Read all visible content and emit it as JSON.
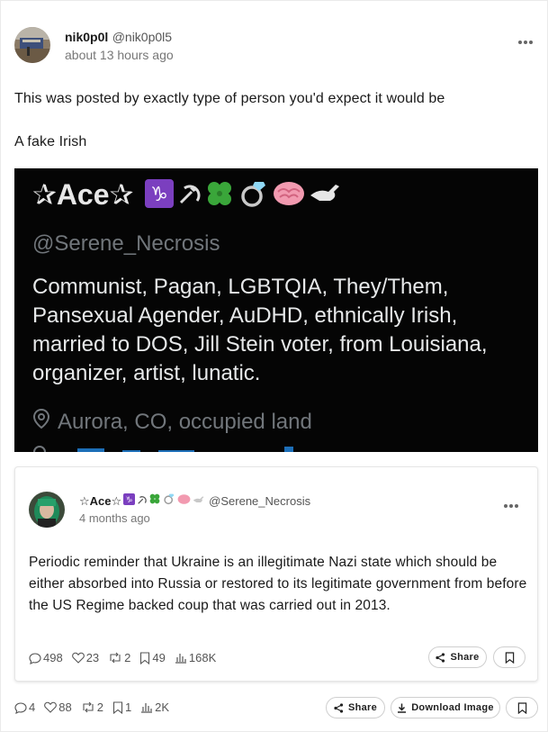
{
  "post": {
    "author_name": "nik0p0l",
    "author_handle": "@nik0p0l5",
    "timestamp": "about 13 hours ago",
    "text_line1": "This was posted by exactly type of person you'd expect it would be",
    "text_line2": "A fake Irish",
    "stats": {
      "replies": "4",
      "likes": "88",
      "reposts": "2",
      "bookmarks": "1",
      "views": "2K"
    },
    "share_label": "Share",
    "download_label": "Download Image"
  },
  "image": {
    "display_name": "✰Ace✰",
    "handle": "@Serene_Necrosis",
    "bio": "Communist, Pagan, LGBTQIA, They/Them, Pansexual Agender, AuDHD, ethnically Irish, married to DOS, Jill Stein voter, from Louisiana, organizer, artist, lunatic.",
    "location": "Aurora, CO, occupied land"
  },
  "quote": {
    "author_name": "☆Ace☆",
    "author_handle": "@Serene_Necrosis",
    "timestamp": "4 months ago",
    "text": "Periodic reminder that Ukraine is an illegitimate Nazi state which should be either absorbed into Russia or restored to its legitimate government from before the US Regime backed coup that was carried out in 2013.",
    "stats": {
      "replies": "498",
      "likes": "23",
      "reposts": "2",
      "bookmarks": "49",
      "views": "168K"
    },
    "share_label": "Share"
  },
  "colors": {
    "image_bg": "#050505",
    "image_text": "#e7e9ea",
    "image_muted": "#71767b",
    "capricorn_purple": "#7b3fbf"
  },
  "icons": [
    "menu-dots-icon",
    "capricorn-icon",
    "hammer-sickle-icon",
    "clover-icon",
    "ring-icon",
    "brain-icon",
    "bird-icon",
    "location-pin-icon",
    "reply-icon",
    "heart-icon",
    "repost-icon",
    "bookmark-icon",
    "views-icon",
    "share-icon",
    "download-icon"
  ]
}
